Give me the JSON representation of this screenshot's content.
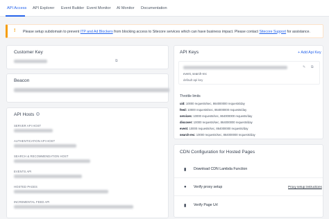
{
  "tabs": {
    "items": [
      {
        "label": "API Access"
      },
      {
        "label": "API Explorer"
      },
      {
        "label": "Event Builder"
      },
      {
        "label": "Event Monitor"
      },
      {
        "label": "AI Monitor"
      },
      {
        "label": "Documentation"
      }
    ],
    "active": "API Access"
  },
  "warning": {
    "icon": "!",
    "text_before": "Please setup subdomain to prevent ",
    "link1": "ITP and Ad Blockers",
    "text_middle": " from blocking access to Sitecore services which can have business impact. Please contact ",
    "link2": "Sitecore Support",
    "text_after": " for assistance."
  },
  "customer_key": {
    "title": "Customer Key"
  },
  "beacon": {
    "title": "Beacon"
  },
  "api_hosts": {
    "title": "API Hosts",
    "labels": [
      "Server API Host",
      "Authentication API Host",
      "Search & Recommendation Host",
      "Events API",
      "Hosted Pages",
      "Incremental Feed API"
    ]
  },
  "api_keys": {
    "title": "API Keys",
    "add_label": "+ Add Api Key",
    "scopes": "event, search-rec",
    "key_name": "default api key",
    "throttle_title": "Throttle limits",
    "throttle": [
      {
        "name": "uid:",
        "value": "10000 requests/sec, 864000000 requests/day"
      },
      {
        "name": "feed:",
        "value": "10000 requests/sec, 864000000 requests/day"
      },
      {
        "name": "services:",
        "value": "10000 requests/sec, 864000000 requests/day"
      },
      {
        "name": "discover:",
        "value": "10000 requests/sec, 864000000 requests/day"
      },
      {
        "name": "event:",
        "value": "10000 requests/sec, 864000000 requests/day"
      },
      {
        "name": "search-rec:",
        "value": "10000 requests/sec, 864000000 requests/day"
      }
    ]
  },
  "cdn": {
    "title": "CDN Configuration for Hosted Pages",
    "rows": [
      {
        "label": "Download CDN Lambda Function"
      },
      {
        "label": "Verify proxy setup",
        "link": "Proxy setup instructions"
      },
      {
        "label": "Verify Page Url"
      }
    ]
  }
}
